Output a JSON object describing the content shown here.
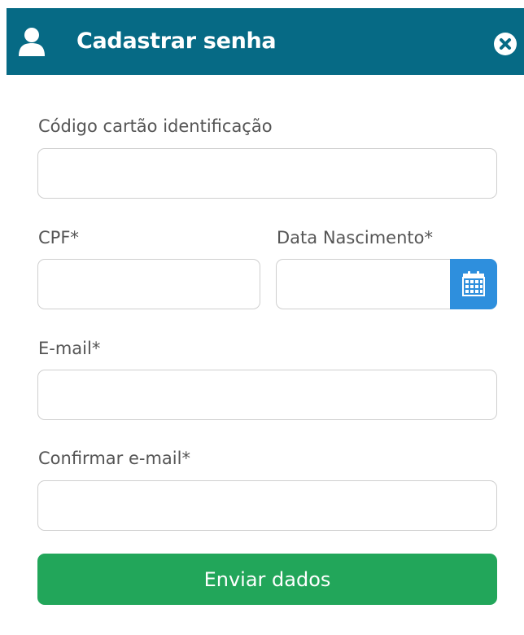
{
  "header": {
    "title": "Cadastrar senha",
    "icon": "user-icon",
    "close_icon": "close-icon",
    "background_color": "#066a85"
  },
  "form": {
    "card_code": {
      "label": "Código cartão identificação",
      "value": "",
      "placeholder": ""
    },
    "cpf": {
      "label": "CPF*",
      "value": "",
      "placeholder": ""
    },
    "birth_date": {
      "label": "Data Nascimento*",
      "value": "",
      "placeholder": "",
      "picker_icon": "calendar-icon"
    },
    "email": {
      "label": "E-mail*",
      "value": "",
      "placeholder": ""
    },
    "confirm_email": {
      "label": "Confirmar e-mail*",
      "value": "",
      "placeholder": ""
    }
  },
  "submit": {
    "label": "Enviar dados",
    "color": "#22a65a"
  },
  "colors": {
    "accent": "#2e8fdd",
    "label_text": "#555555"
  }
}
